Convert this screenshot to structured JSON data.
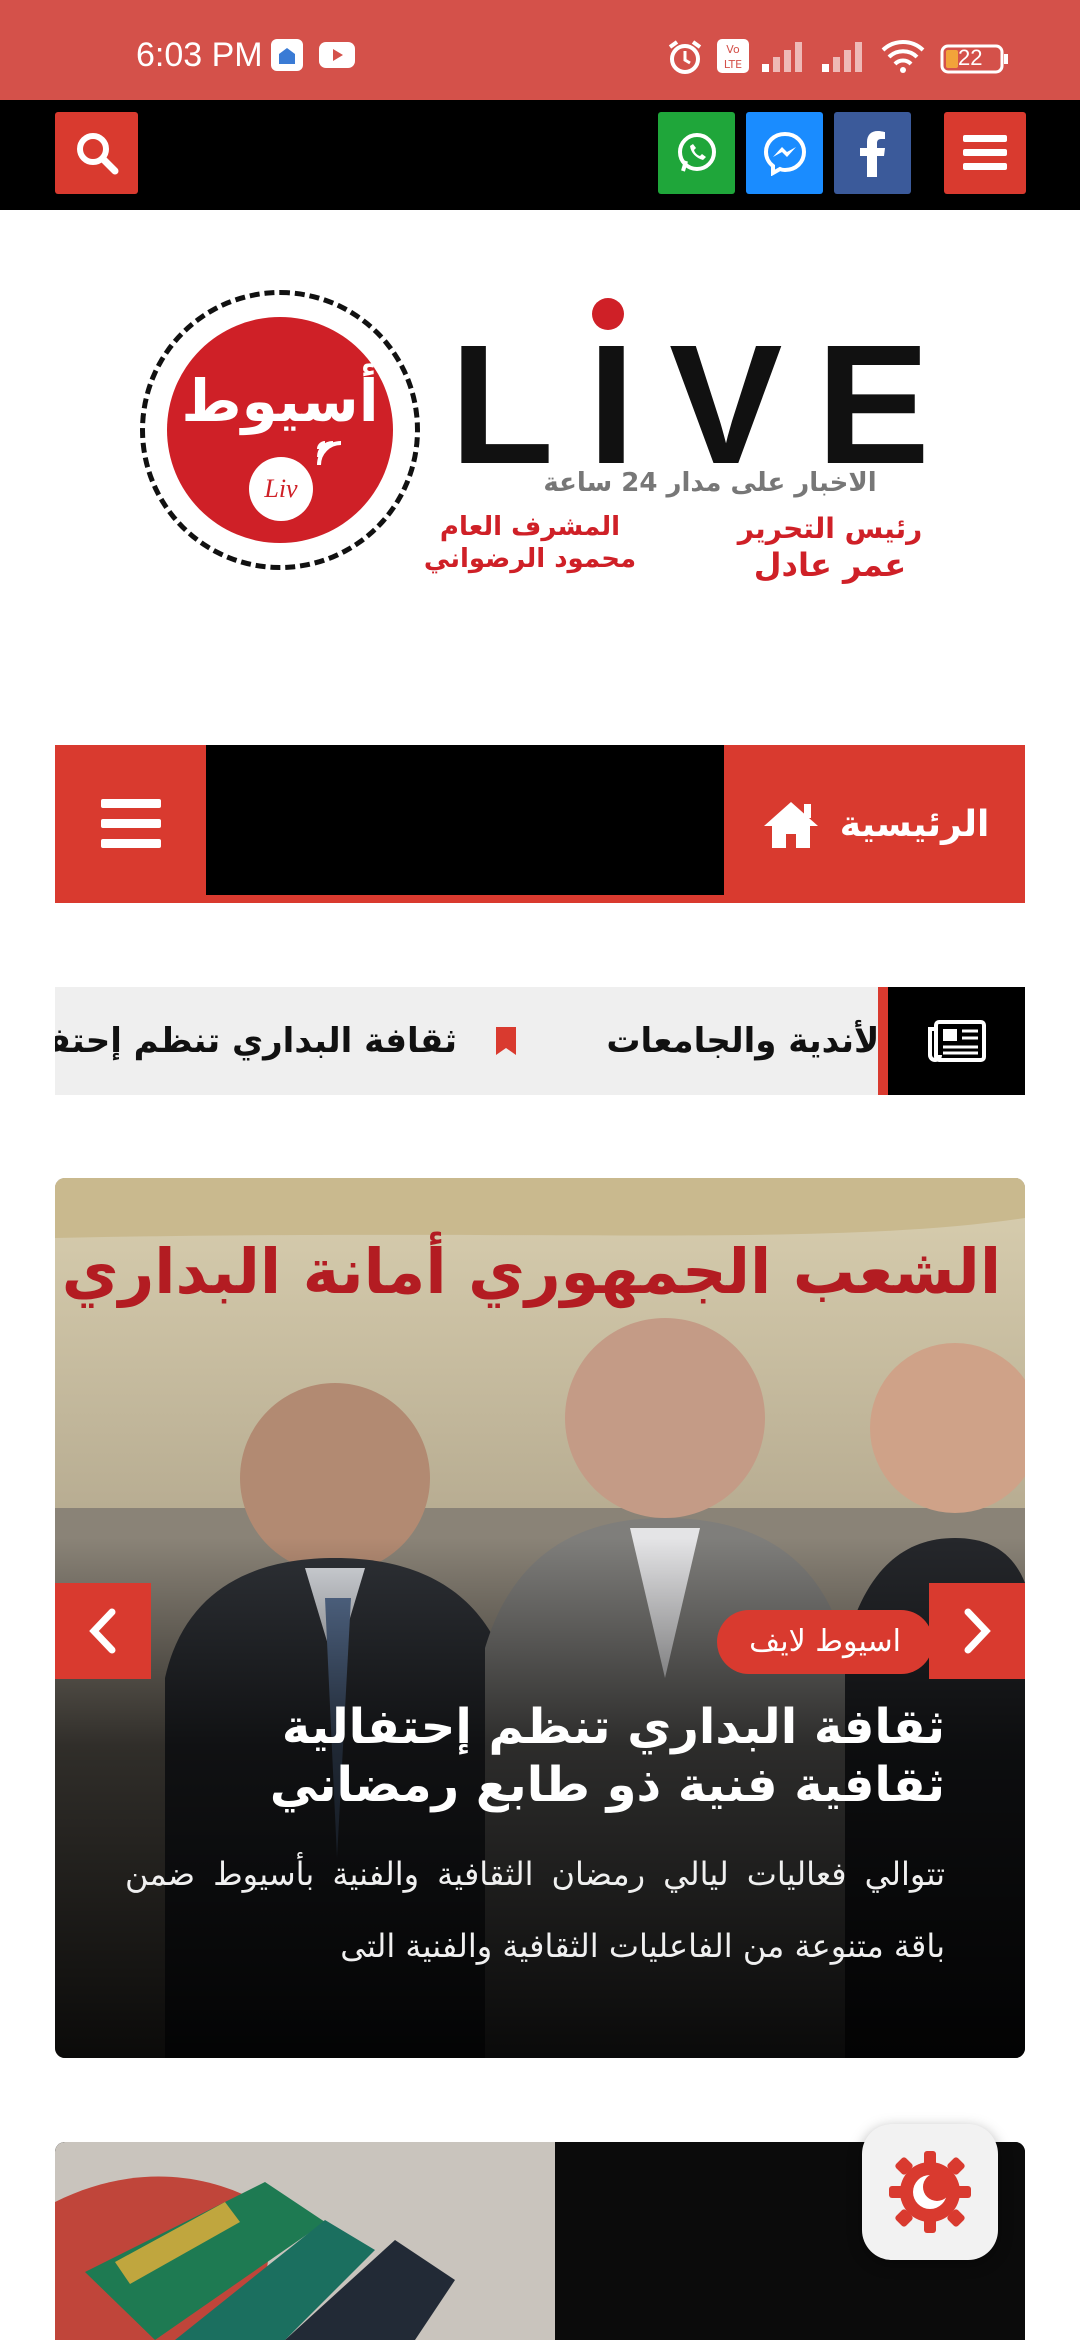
{
  "status_bar": {
    "time": "6:03 PM",
    "battery": "22"
  },
  "colors": {
    "brand_red": "#d93a2f",
    "status_bar": "#d4514a",
    "whatsapp": "#1fa63a",
    "messenger": "#1a8cff",
    "facebook": "#3b5a9a"
  },
  "logo": {
    "seal_text": "أسيوط",
    "seal_sub": "Liv",
    "wordmark": "LIVE",
    "tagline": "الاخبار على مدار 24 ساعة",
    "supervisor_title": "المشرف العام",
    "supervisor_name": "محمود الرضواني",
    "editor_title": "رئيس التحرير",
    "editor_name": "عمر عادل"
  },
  "nav": {
    "home_label": "الرئيسية"
  },
  "ticker": {
    "item_1": "ثقافة البداري تنظم إحتفالية ثقافية فنية ذو طابع رمضاني",
    "item_2": "الأندية والجامعات"
  },
  "featured": {
    "badge": "اسيوط لايف",
    "title": "ثقافة البداري تنظم إحتفالية ثقافية فنية ذو طابع رمضاني",
    "excerpt": "تتوالي فعاليات ليالي رمضان الثقافية والفنية بأسيوط ضمن باقة متنوعة من الفاعليات الثقافية والفنية التى",
    "photo_banner_text": "حزب الشعب الجمهوري أمانة البداري"
  }
}
